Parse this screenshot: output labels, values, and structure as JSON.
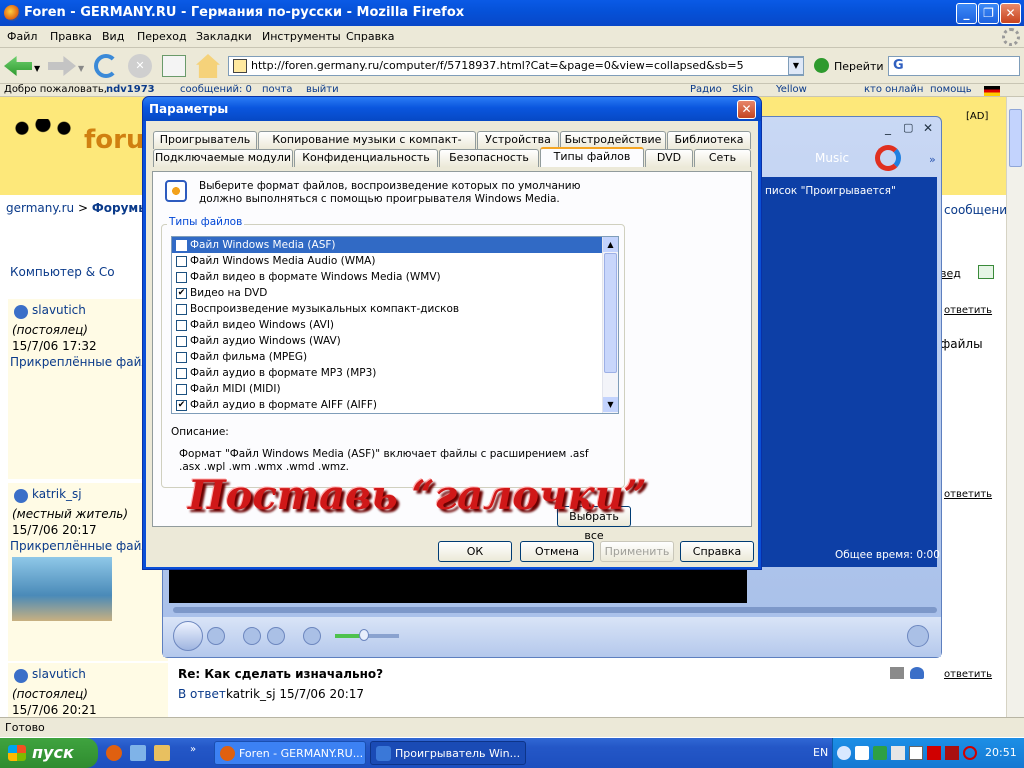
{
  "firefox": {
    "title": "Foren - GERMANY.RU - Германия по-русски - Mozilla Firefox",
    "menu": [
      "Файл",
      "Правка",
      "Вид",
      "Переход",
      "Закладки",
      "Инструменты",
      "Справка"
    ],
    "url": "http://foren.germany.ru/computer/f/5718937.html?Cat=&page=0&view=collapsed&sb=5",
    "go_label": "Перейти",
    "status": "Готово"
  },
  "site_bar": {
    "welcome": "Добро пожаловать,",
    "user": "ndv1973",
    "messages": "сообщений: 0",
    "mail": "почта",
    "exit": "выйти",
    "radio": "Радио",
    "skin": "Skin",
    "yellow": "Yellow",
    "online": "кто онлайн",
    "help": "помощь"
  },
  "web": {
    "logo_text": "forum",
    "ad_label": "[AD]",
    "breadcrumb_site": "germany.ru",
    "breadcrumb_sep": ">",
    "breadcrumb_forum": "Форумы",
    "category": "Компьютер & Co",
    "messages_link": "сообщения",
    "posts": [
      {
        "author": "slavutich",
        "rank": "(постоялец)",
        "date": "15/7/06 17:32",
        "attach": "Прикреплённые файлы"
      },
      {
        "author": "katrik_sj",
        "rank": "(местный житель)",
        "date": "15/7/06 20:17",
        "attach": "Прикреплённые файлы"
      },
      {
        "author": "slavutich",
        "rank": "(постоялец)",
        "date": "15/7/06 20:21",
        "attach": ""
      }
    ],
    "reply_label": "ответить",
    "files_text": "файлы",
    "last_post_title": "Re: Как сделать изначально?",
    "reply_to": "В ответ",
    "reply_to_meta": "katrik_sj 15/7/06 20:17",
    "tree_label": "вед"
  },
  "wmp": {
    "music_tab": "Music",
    "playlist_label": "писок \"Проигрывается\"",
    "total_time": "Общее время: 0:00"
  },
  "dialog": {
    "title": "Параметры",
    "tabs_row1": [
      "Проигрыватель",
      "Копирование музыки с компакт-диска",
      "Устройства",
      "Быстродействие",
      "Библиотека"
    ],
    "tabs_row2": [
      "Подключаемые модули",
      "Конфиденциальность",
      "Безопасность",
      "Типы файлов",
      "DVD",
      "Сеть"
    ],
    "active_tab": "Типы файлов",
    "intro": "Выберите формат файлов, воспроизведение которых по умолчанию должно выполняться с помощью проигрывателя Windows Media.",
    "group_label": "Типы файлов",
    "file_types": [
      {
        "label": "Файл Windows Media (ASF)",
        "checked": false,
        "selected": true
      },
      {
        "label": "Файл Windows Media Audio (WMA)",
        "checked": false,
        "selected": false
      },
      {
        "label": "Файл видео в формате Windows Media (WMV)",
        "checked": false,
        "selected": false
      },
      {
        "label": "Видео на DVD",
        "checked": true,
        "selected": false
      },
      {
        "label": "Воспроизведение музыкальных компакт-дисков",
        "checked": false,
        "selected": false
      },
      {
        "label": "Файл видео Windows (AVI)",
        "checked": false,
        "selected": false
      },
      {
        "label": "Файл аудио Windows (WAV)",
        "checked": false,
        "selected": false
      },
      {
        "label": "Файл фильма (MPEG)",
        "checked": false,
        "selected": false
      },
      {
        "label": "Файл аудио в формате MP3 (MP3)",
        "checked": false,
        "selected": false
      },
      {
        "label": "Файл MIDI (MIDI)",
        "checked": false,
        "selected": false
      },
      {
        "label": "Файл аудио в формате AIFF (AIFF)",
        "checked": true,
        "selected": false
      }
    ],
    "description_label": "Описание:",
    "description_text": "Формат \"Файл Windows Media (ASF)\" включает файлы с расширением .asf .asx .wpl .wm .wmx .wmd .wmz.",
    "select_all": "Выбрать все",
    "ok": "ОК",
    "cancel": "Отмена",
    "apply": "Применить",
    "help": "Справка"
  },
  "overlay": "Поставь “галочки”",
  "taskbar": {
    "start": "пуск",
    "tasks": [
      "Foren - GERMANY.RU...",
      "Проигрыватель Win..."
    ],
    "lang": "EN",
    "clock": "20:51"
  },
  "colors": {
    "xp_blue": "#0a56de",
    "selection": "#316ac5",
    "overlay_red": "#d01818",
    "start_green": "#3a9a3a"
  }
}
